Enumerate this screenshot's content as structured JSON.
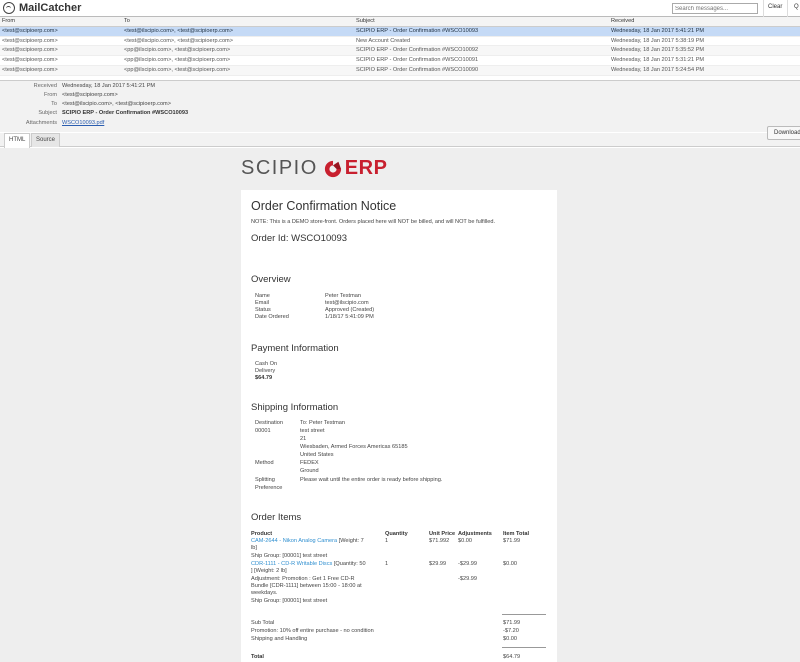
{
  "app": {
    "name": "MailCatcher",
    "search_placeholder": "Search messages...",
    "clear": "Clear",
    "quit_initial": "Q"
  },
  "list": {
    "headers": {
      "from": "From",
      "to": "To",
      "subject": "Subject",
      "received": "Received"
    },
    "rows": [
      {
        "from": "<test@scipioerp.com>",
        "to": "<test@ilscipio.com>, <test@scipioerp.com>",
        "subject": "SCIPIO ERP - Order Confirmation #WSCO10093",
        "received": "Wednesday, 18 Jan 2017 5:41:21 PM"
      },
      {
        "from": "<test@scipioerp.com>",
        "to": "<test@ilscipio.com>, <test@scipioerp.com>",
        "subject": "New Account Created",
        "received": "Wednesday, 18 Jan 2017 5:38:19 PM"
      },
      {
        "from": "<test@scipioerp.com>",
        "to": "<pp@ilscipio.com>, <test@scipioerp.com>",
        "subject": "SCIPIO ERP - Order Confirmation #WSCO10092",
        "received": "Wednesday, 18 Jan 2017 5:35:52 PM"
      },
      {
        "from": "<test@scipioerp.com>",
        "to": "<pp@ilscipio.com>, <test@scipioerp.com>",
        "subject": "SCIPIO ERP - Order Confirmation #WSCO10091",
        "received": "Wednesday, 18 Jan 2017 5:31:21 PM"
      },
      {
        "from": "<test@scipioerp.com>",
        "to": "<pp@ilscipio.com>, <test@scipioerp.com>",
        "subject": "SCIPIO ERP - Order Confirmation #WSCO10090",
        "received": "Wednesday, 18 Jan 2017 5:24:54 PM"
      }
    ]
  },
  "meta": {
    "received_label": "Received",
    "received": "Wednesday, 18 Jan 2017 5:41:21 PM",
    "from_label": "From",
    "from": "<test@scipioerp.com>",
    "to_label": "To",
    "to": "<test@ilscipio.com>, <test@scipioerp.com>",
    "subject_label": "Subject",
    "subject": "SCIPIO ERP - Order Confirmation #WSCO10093",
    "attachments_label": "Attachments",
    "attachment": "WSCO10093.pdf"
  },
  "tabs": {
    "html": "HTML",
    "source": "Source",
    "download": "Download"
  },
  "email": {
    "brand_left": "SCIPIO",
    "brand_right": "ERP",
    "title": "Order Confirmation Notice",
    "note": "NOTE: This is a DEMO store-front. Orders placed here will NOT be billed, and will NOT be fulfilled.",
    "order_id": "Order Id: WSCO10093",
    "overview_title": "Overview",
    "overview": [
      {
        "label": "Name",
        "value": "Peter Testman"
      },
      {
        "label": "Email",
        "value": "test@ilscipio.com"
      },
      {
        "label": "Status",
        "value": "Approved (Created)"
      },
      {
        "label": "Date Ordered",
        "value": "1/18/17 5:41:09 PM"
      }
    ],
    "payment_title": "Payment Information",
    "payment_line1": "Cash On",
    "payment_line2": "Delivery",
    "payment_amount": "$64.79",
    "shipping_title": "Shipping Information",
    "ship_dest_label": "Destination",
    "ship_dest_id": "00001",
    "ship_address": [
      "To: Peter Testman",
      "test street",
      "21",
      "Wiesbaden, Armed Forces Americas 65185",
      "United States"
    ],
    "ship_method_label": "Method",
    "ship_method": [
      "FEDEX",
      "Ground"
    ],
    "ship_split_label": [
      "Splitting",
      "Preference"
    ],
    "ship_split": "Please wait until the entire order is ready before shipping.",
    "items_title": "Order Items",
    "items_headers": {
      "product": "Product",
      "qty": "Quantity",
      "unit": "Unit Price",
      "adj": "Adjustments",
      "total": "Item Total"
    },
    "item1": {
      "link": "CAM-2644 - Nikon Analog Camera",
      "rest": " [Weight: 7",
      "line2": "lb]",
      "ship": "Ship Group: [00001] test street",
      "qty": "1",
      "unit": "$71.992",
      "adj": "$0.00",
      "total": "$71.99"
    },
    "item2": {
      "link": "CDR-1111 - CD-R Writable Discs",
      "rest": " [Quantity: 50",
      "line2": "] [Weight: 2 lb]",
      "adj_text": [
        "Adjustment: Promotion : Get 1 Free CD-R",
        "Bundle [CDR-1111] between 15:00 - 18:00 at",
        "weekdays."
      ],
      "ship": "Ship Group: [00001] test street",
      "qty": "1",
      "unit": "$29.99",
      "adj": "-$29.99",
      "adj2": "-$29.99",
      "total": "$0.00"
    },
    "subtotal_label": "Sub Total",
    "subtotal": "$71.99",
    "promo_label": "Promotion: 10% off entire purchase - no condition",
    "promo": "-$7.20",
    "shipping_label": "Shipping and Handling",
    "shipping": "$0.00",
    "total_label": "Total",
    "total": "$64.79"
  }
}
